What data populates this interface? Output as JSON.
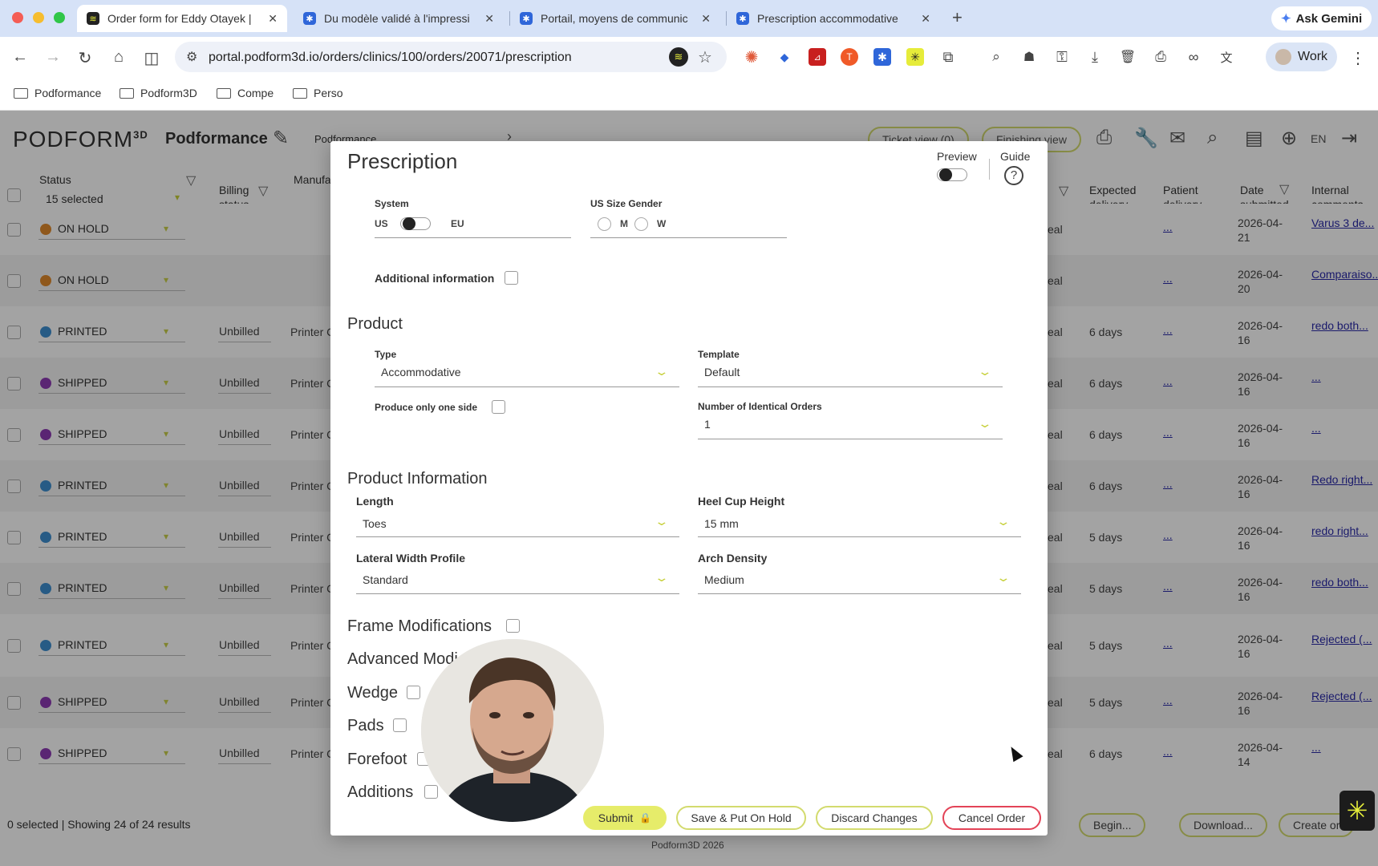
{
  "browser": {
    "tabs": [
      {
        "title": "Order form for Eddy Otayek |",
        "active": true
      },
      {
        "title": "Du modèle validé à l'impressi",
        "active": false
      },
      {
        "title": "Portail, moyens de communic",
        "active": false
      },
      {
        "title": "Prescription accommodative",
        "active": false
      }
    ],
    "ask_gemini": "Ask Gemini",
    "url": "portal.podform3d.io/orders/clinics/100/orders/20071/prescription",
    "profile": "Work",
    "bookmarks": [
      "Podformance",
      "Podform3D",
      "Compe",
      "Perso"
    ]
  },
  "app": {
    "logo": "PODFORM",
    "logo_sup": "3D",
    "org_name": "Podformance",
    "org_select": "Podformance",
    "ticket_view": "Ticket view (0)",
    "finishing_view": "Finishing view",
    "language": "EN",
    "columns": {
      "status": "Status",
      "status_filter": "15 selected",
      "billing": "Billing status",
      "manufacturer": "Manufa",
      "expected_delivery": "Expected delivery",
      "patient_delivery": "Patient delivery",
      "date_submitted": "Date submitted",
      "internal_comments": "Internal comments"
    },
    "rows": [
      {
        "status": "ON HOLD",
        "billing": "",
        "manufacturer": "",
        "type": "eal",
        "expected": "",
        "patient": "...",
        "date": "2026-04-21",
        "comment": "Varus 3 de..."
      },
      {
        "status": "ON HOLD",
        "billing": "",
        "manufacturer": "",
        "type": "eal",
        "expected": "",
        "patient": "...",
        "date": "2026-04-20",
        "comment": "Comparaiso..."
      },
      {
        "status": "PRINTED",
        "billing": "Unbilled",
        "manufacturer": "Printer C",
        "type": "eal",
        "expected": "6 days",
        "patient": "...",
        "date": "2026-04-16",
        "comment": "redo both..."
      },
      {
        "status": "SHIPPED",
        "billing": "Unbilled",
        "manufacturer": "Printer C",
        "type": "eal",
        "expected": "6 days",
        "patient": "...",
        "date": "2026-04-16",
        "comment": "..."
      },
      {
        "status": "SHIPPED",
        "billing": "Unbilled",
        "manufacturer": "Printer C",
        "type": "eal",
        "expected": "6 days",
        "patient": "...",
        "date": "2026-04-16",
        "comment": "..."
      },
      {
        "status": "PRINTED",
        "billing": "Unbilled",
        "manufacturer": "Printer C",
        "type": "eal",
        "expected": "6 days",
        "patient": "...",
        "date": "2026-04-16",
        "comment": "Redo right..."
      },
      {
        "status": "PRINTED",
        "billing": "Unbilled",
        "manufacturer": "Printer C",
        "type": "eal",
        "expected": "5 days",
        "patient": "...",
        "date": "2026-04-16",
        "comment": "redo right..."
      },
      {
        "status": "PRINTED",
        "billing": "Unbilled",
        "manufacturer": "Printer C",
        "type": "eal",
        "expected": "5 days",
        "patient": "...",
        "date": "2026-04-16",
        "comment": "redo both..."
      },
      {
        "status": "PRINTED",
        "billing": "Unbilled",
        "manufacturer": "Printer C",
        "type": "eal",
        "expected": "5 days",
        "patient": "...",
        "date": "2026-04-16",
        "comment": "Rejected (..."
      },
      {
        "status": "SHIPPED",
        "billing": "Unbilled",
        "manufacturer": "Printer C",
        "type": "eal",
        "expected": "5 days",
        "patient": "...",
        "date": "2026-04-16",
        "comment": "Rejected (..."
      },
      {
        "status": "SHIPPED",
        "billing": "Unbilled",
        "manufacturer": "Printer C",
        "type": "eal",
        "expected": "6 days",
        "patient": "...",
        "date": "2026-04-14",
        "comment": "..."
      }
    ],
    "footer_status": "0 selected | Showing 24 of 24 results",
    "footer_buttons": [
      "Begin...",
      "Download...",
      "Create or"
    ],
    "copyright": "Podform3D 2026"
  },
  "modal": {
    "title": "Prescription",
    "preview_label": "Preview",
    "guide_label": "Guide",
    "system_label": "System",
    "system_us": "US",
    "system_eu": "EU",
    "us_size_gender_label": "US Size Gender",
    "gender_m": "M",
    "gender_w": "W",
    "additional_info_label": "Additional information",
    "product_section": "Product",
    "type_label": "Type",
    "type_value": "Accommodative",
    "template_label": "Template",
    "template_value": "Default",
    "one_side_label": "Produce only one side",
    "identical_orders_label": "Number of Identical Orders",
    "identical_orders_value": "1",
    "product_info_section": "Product Information",
    "length_label": "Length",
    "length_value": "Toes",
    "heel_cup_label": "Heel Cup Height",
    "heel_cup_value": "15 mm",
    "lateral_width_label": "Lateral Width Profile",
    "lateral_width_value": "Standard",
    "arch_density_label": "Arch Density",
    "arch_density_value": "Medium",
    "frame_mod_label": "Frame Modifications",
    "advanced_mod_label": "Advanced Modi",
    "wedge_label": "Wedge",
    "pads_label": "Pads",
    "forefoot_label": "Forefoot",
    "additions_label": "Additions",
    "submit": "Submit",
    "save_hold": "Save & Put On Hold",
    "discard": "Discard Changes",
    "cancel_order": "Cancel Order"
  },
  "colors": {
    "accent": "#e6ec6a",
    "on_hold": "#e08a2c",
    "printed": "#3d8fd1",
    "shipped": "#8d3bb5",
    "danger": "#e34357",
    "link": "#2a2aa8"
  }
}
